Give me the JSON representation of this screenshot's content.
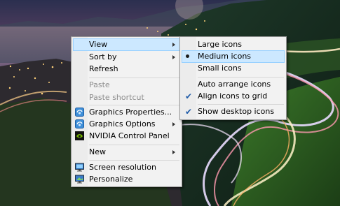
{
  "colors": {
    "menu_bg": "#f2f2f2",
    "highlight_bg": "#cce8ff",
    "highlight_border": "#99d1ff",
    "disabled_text": "#8d8d8d",
    "check_color": "#1e5aa8"
  },
  "context_menu": {
    "items": [
      {
        "label": "View",
        "submenu": true,
        "highlighted": true
      },
      {
        "label": "Sort by",
        "submenu": true
      },
      {
        "label": "Refresh"
      },
      {
        "label": "Paste",
        "disabled": true
      },
      {
        "label": "Paste shortcut",
        "disabled": true
      },
      {
        "label": "Graphics Properties...",
        "icon": "intel-graphics-icon"
      },
      {
        "label": "Graphics Options",
        "icon": "intel-graphics-icon",
        "submenu": true
      },
      {
        "label": "NVIDIA Control Panel",
        "icon": "nvidia-icon"
      },
      {
        "label": "New",
        "submenu": true
      },
      {
        "label": "Screen resolution",
        "icon": "screen-resolution-icon"
      },
      {
        "label": "Personalize",
        "icon": "personalize-icon"
      }
    ]
  },
  "view_submenu": {
    "items": [
      {
        "label": "Large icons"
      },
      {
        "label": "Medium icons",
        "selected": true,
        "highlighted": true
      },
      {
        "label": "Small icons"
      },
      {
        "label": "Auto arrange icons"
      },
      {
        "label": "Align icons to grid",
        "checked": true
      },
      {
        "label": "Show desktop icons",
        "checked": true
      }
    ]
  }
}
